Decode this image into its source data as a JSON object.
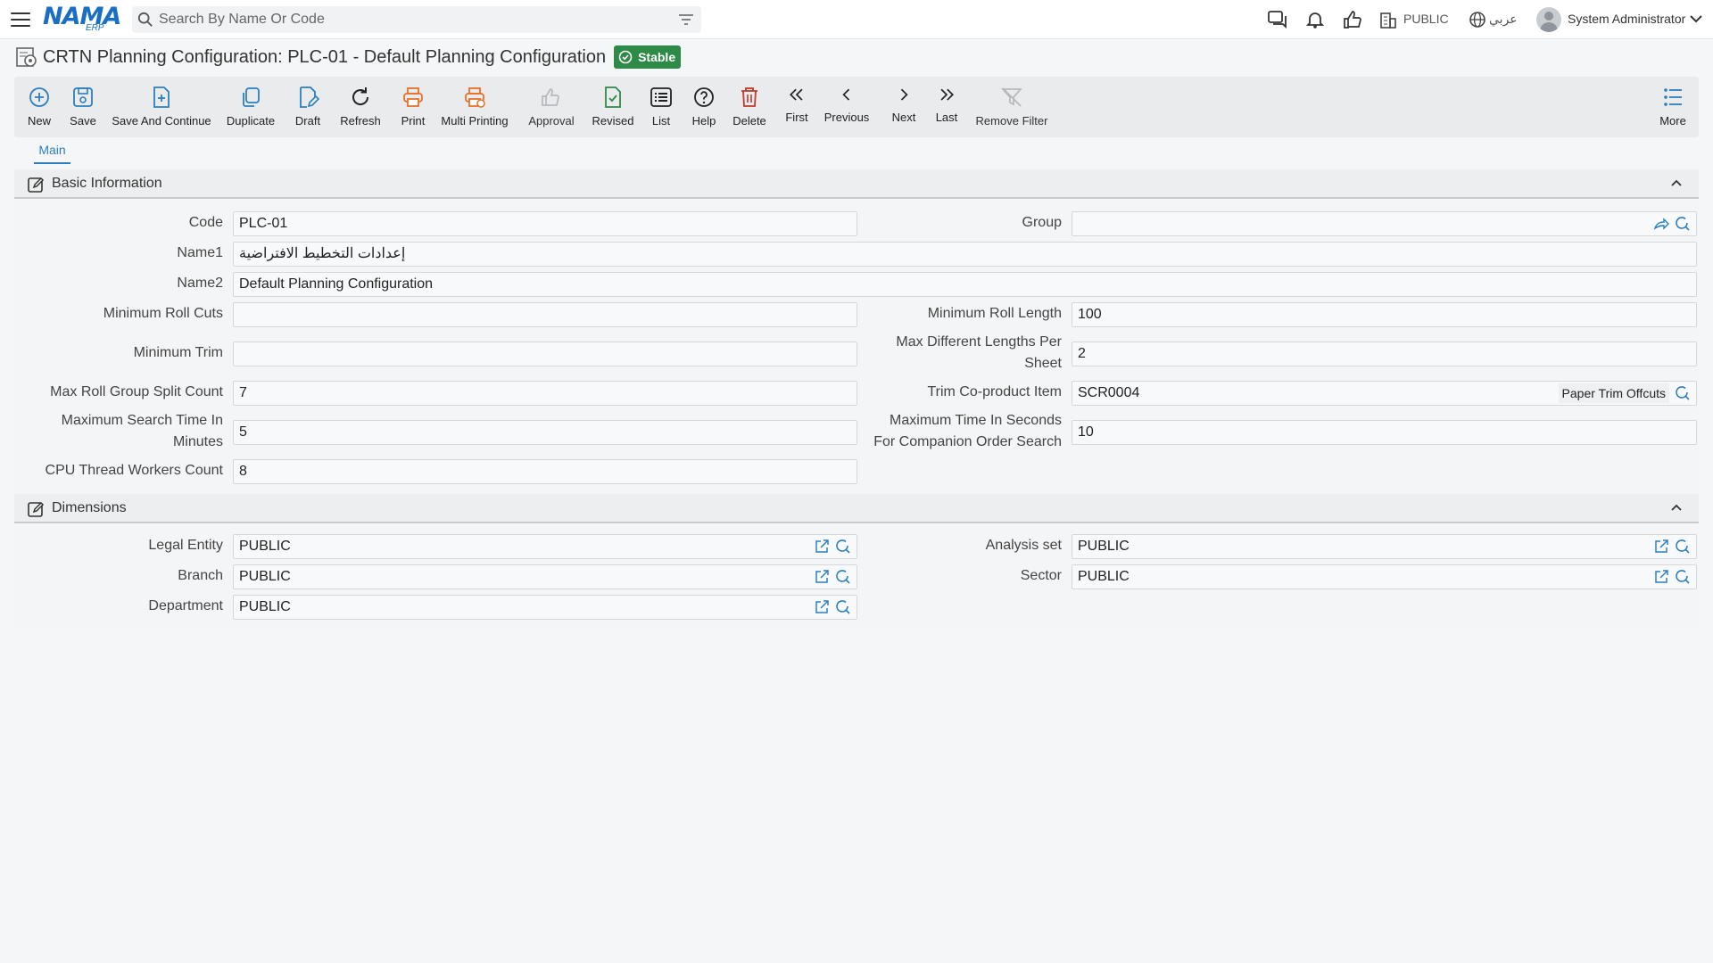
{
  "topbar": {
    "logo": "NAMA",
    "logo_sub": "ERP",
    "search_placeholder": "Search By Name Or Code",
    "org": "PUBLIC",
    "language": "عربي",
    "user": "System Administrator"
  },
  "page": {
    "title": "CRTN Planning Configuration: PLC-01 - Default Planning Configuration",
    "status": "Stable"
  },
  "toolbar": {
    "new": "New",
    "save": "Save",
    "save_continue": "Save And Continue",
    "duplicate": "Duplicate",
    "draft": "Draft",
    "refresh": "Refresh",
    "print": "Print",
    "multi_printing": "Multi Printing",
    "approval": "Approval",
    "revised": "Revised",
    "list": "List",
    "help": "Help",
    "delete": "Delete",
    "first": "First",
    "previous": "Previous",
    "next": "Next",
    "last": "Last",
    "remove_filter": "Remove Filter",
    "more": "More"
  },
  "tabs": {
    "main": "Main"
  },
  "basic": {
    "header": "Basic Information",
    "code_label": "Code",
    "code": "PLC-01",
    "group_label": "Group",
    "group": "",
    "name1_label": "Name1",
    "name1": "إعدادات التخطيط الافتراضية",
    "name2_label": "Name2",
    "name2": "Default Planning Configuration",
    "min_roll_cuts_label": "Minimum Roll Cuts",
    "min_roll_cuts": "",
    "min_roll_length_label": "Minimum Roll Length",
    "min_roll_length": "100",
    "min_trim_label": "Minimum Trim",
    "min_trim": "",
    "max_diff_lengths_label_1": "Max Different Lengths Per",
    "max_diff_lengths_label_2": "Sheet",
    "max_diff_lengths": "2",
    "max_roll_group_label": "Max Roll Group Split Count",
    "max_roll_group": "7",
    "trim_coproduct_label": "Trim Co-product Item",
    "trim_coproduct": "SCR0004",
    "trim_coproduct_desc": "Paper Trim Offcuts",
    "max_search_time_label_1": "Maximum Search Time In",
    "max_search_time_label_2": "Minutes",
    "max_search_time": "5",
    "max_time_seconds_label_1": "Maximum Time In Seconds",
    "max_time_seconds_label_2": "For Companion Order Search",
    "max_time_seconds": "10",
    "cpu_workers_label": "CPU Thread Workers Count",
    "cpu_workers": "8"
  },
  "dimensions": {
    "header": "Dimensions",
    "legal_entity_label": "Legal Entity",
    "legal_entity": "PUBLIC",
    "analysis_set_label": "Analysis set",
    "analysis_set": "PUBLIC",
    "branch_label": "Branch",
    "branch": "PUBLIC",
    "sector_label": "Sector",
    "sector": "PUBLIC",
    "department_label": "Department",
    "department": "PUBLIC"
  },
  "colors": {
    "accent": "#2c7fbf",
    "stable_badge": "#2e8b47",
    "print_orange": "#e8712a",
    "delete_red": "#c0392b",
    "revised_green": "#2e8b47"
  }
}
